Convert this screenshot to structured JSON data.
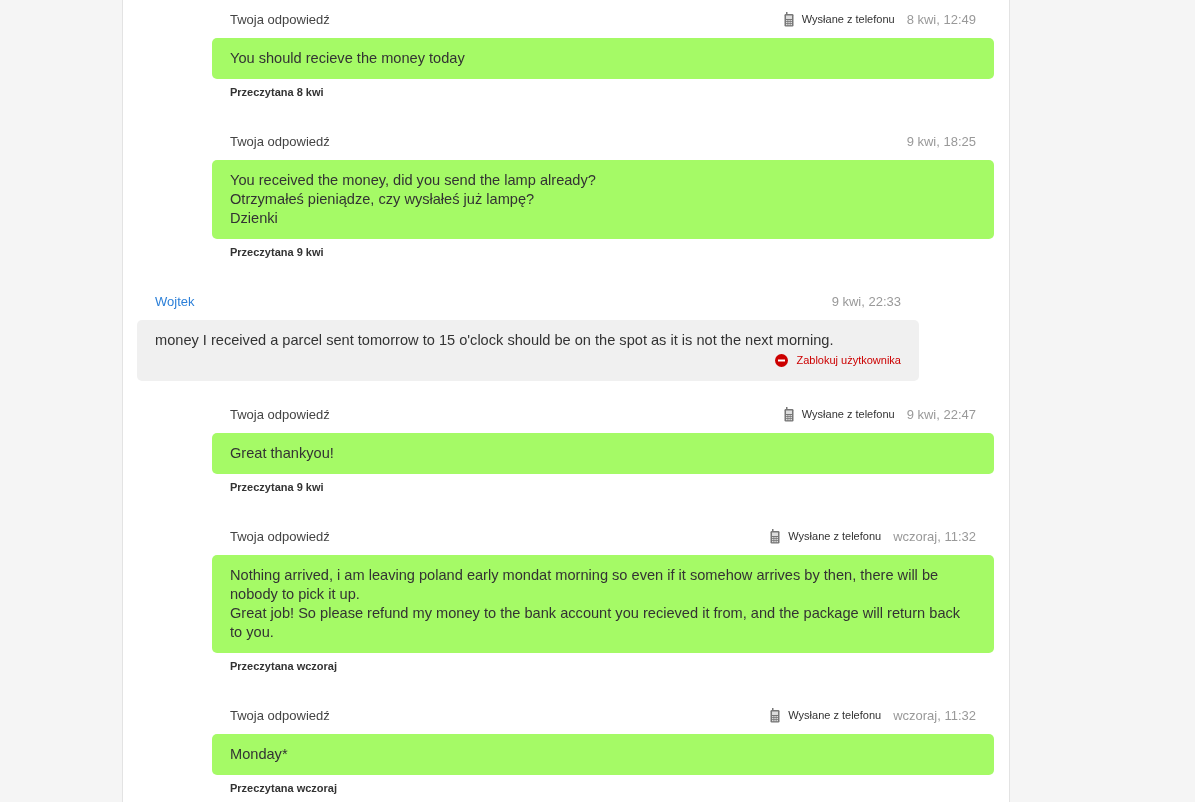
{
  "messages": [
    {
      "kind": "outgoing",
      "author": "Twoja odpowiedź",
      "sent_from": "Wysłane z telefonu",
      "time": "8 kwi, 12:49",
      "paragraphs": [
        "You should recieve the money today"
      ],
      "read": "Przeczytana 8 kwi"
    },
    {
      "kind": "outgoing",
      "author": "Twoja odpowiedź",
      "time": "9 kwi, 18:25",
      "paragraphs": [
        "You received the money, did you send the lamp already?",
        "Otrzymałeś pieniądze, czy wysłałeś już lampę?",
        "Dzienki"
      ],
      "read": "Przeczytana 9 kwi"
    },
    {
      "kind": "incoming",
      "author": "Wojtek",
      "time": "9 kwi, 22:33",
      "paragraphs": [
        "money I received a parcel sent tomorrow to 15 o'clock should be on the spot as it is not the next morning."
      ],
      "block_label": "Zablokuj użytkownika"
    },
    {
      "kind": "outgoing",
      "author": "Twoja odpowiedź",
      "sent_from": "Wysłane z telefonu",
      "time": "9 kwi, 22:47",
      "paragraphs": [
        "Great thankyou!"
      ],
      "read": "Przeczytana 9 kwi"
    },
    {
      "kind": "outgoing",
      "author": "Twoja odpowiedź",
      "sent_from": "Wysłane z telefonu",
      "time": "wczoraj, 11:32",
      "paragraphs": [
        "Nothing arrived, i am leaving poland early mondat morning so even if it somehow arrives by then, there will be nobody to pick it up.",
        "Great job! So please refund my money to the bank account you recieved it from, and the package will return back to you."
      ],
      "read": "Przeczytana wczoraj"
    },
    {
      "kind": "outgoing",
      "author": "Twoja odpowiedź",
      "sent_from": "Wysłane z telefonu",
      "time": "wczoraj, 11:32",
      "paragraphs": [
        "Monday*"
      ],
      "read": "Przeczytana wczoraj"
    }
  ]
}
